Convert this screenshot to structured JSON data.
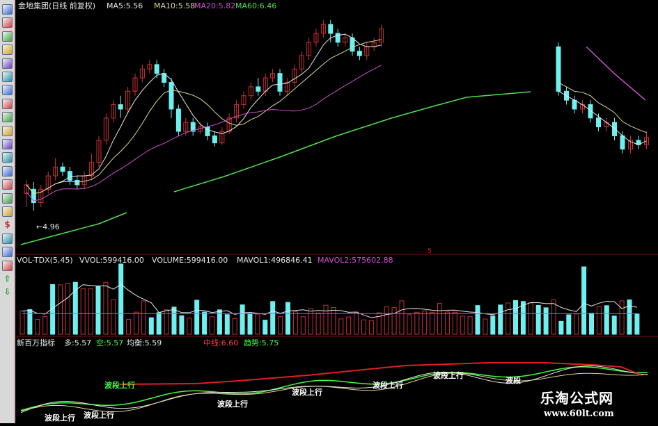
{
  "colors": {
    "background": "#000000",
    "up_candle": "#c83232",
    "down_candle": "#6cf0f0",
    "ma5": "#e8e8e8",
    "ma10": "#e0d890",
    "ma20": "#d050d0",
    "ma60": "#50e050",
    "panel_divider": "#7a1010",
    "red_line": "#e02020",
    "label_red": "#ff4040",
    "label_green": "#40ff40"
  },
  "toolbar": {
    "icons": [
      "kline-icon",
      "trend-icon",
      "chart-icon",
      "table-icon",
      "list-icon",
      "grid-icon",
      "chart-icon",
      "mail-icon",
      "users-icon",
      "note-icon",
      "window-icon",
      "dropdown-icon",
      "window-icon",
      "window-icon",
      "grid-icon",
      "table-icon",
      "dollar-icon",
      "tool-icon",
      "export-icon",
      "pen-icon",
      "arrow-up-icon",
      "arrow-down-icon"
    ]
  },
  "main_header": {
    "title": "金地集团(日线 前复权)",
    "ma5": "MA5:5.56",
    "ma10": "MA10:5.58",
    "ma20": "MA20:5.82",
    "ma60": "MA60:6.46"
  },
  "min_price_label": "4.96",
  "vol_header": {
    "name": "VOL-TDX(5,45)",
    "vvol": "VVOL:599416.00",
    "volume": "VOLUME:599416.00",
    "mavol1": "MAVOL1:496846.41",
    "mavol2": "MAVOL2:575602.88"
  },
  "indicator_header": {
    "name": "新百万指标",
    "duo": "多:5.57",
    "kong": "空:5.57",
    "junheng": "均衡:5.59",
    "zhongxian": "中线:6.60",
    "qushi": "趋势:5.75"
  },
  "annotations": [
    {
      "text": "波段上行"
    },
    {
      "text": "波段上行"
    },
    {
      "text": "波段上行"
    },
    {
      "text": "波段上行"
    },
    {
      "text": "波段上行"
    },
    {
      "text": "波段上行"
    },
    {
      "text": "波段上行"
    }
  ],
  "watermark": {
    "name": "乐淘公式网",
    "url": "www.60lt.com"
  },
  "chart_data": {
    "type": "candlestick",
    "price_ylim": [
      4.5,
      7.2
    ],
    "candles": [
      [
        5.15,
        5.25,
        5.3,
        5.0
      ],
      [
        5.2,
        5.05,
        5.28,
        4.96
      ],
      [
        5.05,
        5.2,
        5.25,
        5.0
      ],
      [
        5.2,
        5.35,
        5.4,
        5.15
      ],
      [
        5.35,
        5.45,
        5.55,
        5.3
      ],
      [
        5.45,
        5.4,
        5.5,
        5.35
      ],
      [
        5.4,
        5.3,
        5.45,
        5.25
      ],
      [
        5.3,
        5.25,
        5.35,
        5.2
      ],
      [
        5.25,
        5.35,
        5.4,
        5.2
      ],
      [
        5.35,
        5.5,
        5.6,
        5.3
      ],
      [
        5.5,
        5.75,
        5.8,
        5.45
      ],
      [
        5.75,
        6.0,
        6.05,
        5.7
      ],
      [
        6.0,
        6.15,
        6.2,
        5.95
      ],
      [
        6.15,
        6.1,
        6.25,
        6.0
      ],
      [
        6.1,
        6.3,
        6.35,
        6.05
      ],
      [
        6.3,
        6.45,
        6.5,
        6.25
      ],
      [
        6.45,
        6.55,
        6.6,
        6.4
      ],
      [
        6.55,
        6.6,
        6.65,
        6.5
      ],
      [
        6.6,
        6.5,
        6.65,
        6.45
      ],
      [
        6.5,
        6.4,
        6.55,
        6.35
      ],
      [
        6.4,
        6.1,
        6.45,
        6.0
      ],
      [
        6.1,
        5.85,
        6.15,
        5.8
      ],
      [
        5.85,
        5.95,
        6.0,
        5.8
      ],
      [
        5.95,
        5.85,
        6.0,
        5.8
      ],
      [
        5.85,
        5.9,
        5.95,
        5.82
      ],
      [
        5.9,
        5.8,
        5.95,
        5.75
      ],
      [
        5.8,
        5.72,
        5.85,
        5.68
      ],
      [
        5.72,
        5.85,
        5.9,
        5.7
      ],
      [
        5.85,
        6.0,
        6.05,
        5.82
      ],
      [
        6.0,
        6.15,
        6.2,
        5.95
      ],
      [
        6.15,
        6.25,
        6.3,
        6.1
      ],
      [
        6.25,
        6.35,
        6.4,
        6.2
      ],
      [
        6.35,
        6.3,
        6.45,
        6.25
      ],
      [
        6.3,
        6.45,
        6.5,
        6.25
      ],
      [
        6.45,
        6.5,
        6.55,
        6.4
      ],
      [
        6.5,
        6.3,
        6.55,
        6.25
      ],
      [
        6.3,
        6.4,
        6.45,
        6.25
      ],
      [
        6.4,
        6.55,
        6.6,
        6.35
      ],
      [
        6.55,
        6.7,
        6.75,
        6.5
      ],
      [
        6.7,
        6.85,
        6.9,
        6.65
      ],
      [
        6.85,
        6.95,
        7.0,
        6.8
      ],
      [
        6.95,
        7.05,
        7.1,
        6.9
      ],
      [
        7.05,
        6.95,
        7.1,
        6.85
      ],
      [
        6.95,
        6.85,
        7.0,
        6.8
      ],
      [
        6.85,
        6.9,
        6.95,
        6.8
      ],
      [
        6.9,
        6.75,
        6.95,
        6.7
      ],
      [
        6.75,
        6.7,
        6.8,
        6.65
      ],
      [
        6.7,
        6.8,
        6.85,
        6.65
      ],
      [
        6.8,
        6.85,
        6.9,
        6.75
      ],
      [
        6.85,
        7.0,
        7.05,
        6.8
      ]
    ],
    "right_candles": [
      [
        6.8,
        6.3,
        6.85,
        6.25
      ],
      [
        6.3,
        6.2,
        6.35,
        6.15
      ],
      [
        6.2,
        6.1,
        6.25,
        6.05
      ],
      [
        6.1,
        6.15,
        6.2,
        6.05
      ],
      [
        6.15,
        6.0,
        6.2,
        5.95
      ],
      [
        6.0,
        5.9,
        6.05,
        5.85
      ],
      [
        5.9,
        5.95,
        6.0,
        5.85
      ],
      [
        5.95,
        5.8,
        6.0,
        5.75
      ],
      [
        5.8,
        5.65,
        5.85,
        5.6
      ],
      [
        5.65,
        5.75,
        5.8,
        5.6
      ],
      [
        5.75,
        5.7,
        5.8,
        5.65
      ],
      [
        5.7,
        5.78,
        5.85,
        5.65
      ]
    ]
  }
}
